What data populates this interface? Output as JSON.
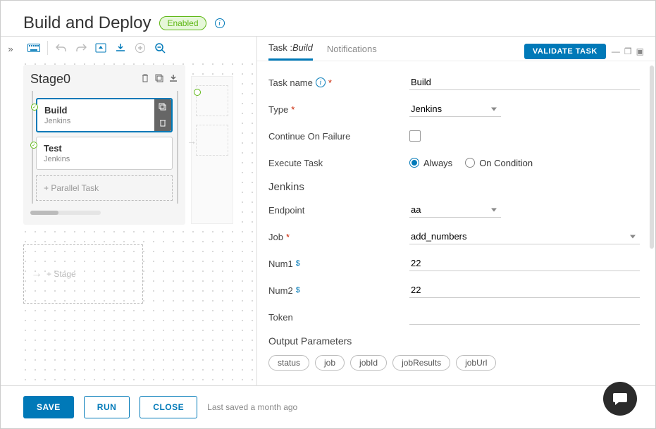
{
  "header": {
    "title": "Build and Deploy",
    "status": "Enabled"
  },
  "toolbar": {
    "icons": [
      "keyboard",
      "undo",
      "redo",
      "collapse",
      "import",
      "add",
      "zoom-out"
    ]
  },
  "stage": {
    "name": "Stage0",
    "tasks": [
      {
        "name": "Build",
        "subtitle": "Jenkins",
        "selected": true,
        "status": "ok"
      },
      {
        "name": "Test",
        "subtitle": "Jenkins",
        "selected": false,
        "status": "ok"
      }
    ],
    "parallel_placeholder": "+ Parallel Task",
    "add_stage_placeholder": "+ Stage"
  },
  "panel": {
    "tabs": {
      "task_prefix": "Task :",
      "task_name": "Build",
      "notifications": "Notifications"
    },
    "validate_btn": "VALIDATE TASK",
    "labels": {
      "task_name": "Task name",
      "type": "Type",
      "continue_on_failure": "Continue On Failure",
      "execute_task": "Execute Task",
      "always": "Always",
      "on_condition": "On Condition",
      "jenkins_section": "Jenkins",
      "endpoint": "Endpoint",
      "job": "Job",
      "num1": "Num1",
      "num2": "Num2",
      "token": "Token",
      "output_params": "Output Parameters"
    },
    "values": {
      "task_name": "Build",
      "type": "Jenkins",
      "continue_on_failure": false,
      "execute_task": "always",
      "endpoint": "aa",
      "job": "add_numbers",
      "num1": "22",
      "num2": "22",
      "token": ""
    },
    "output_params": [
      "status",
      "job",
      "jobId",
      "jobResults",
      "jobUrl"
    ]
  },
  "footer": {
    "save": "SAVE",
    "run": "RUN",
    "close": "CLOSE",
    "last_saved": "Last saved a month ago"
  }
}
